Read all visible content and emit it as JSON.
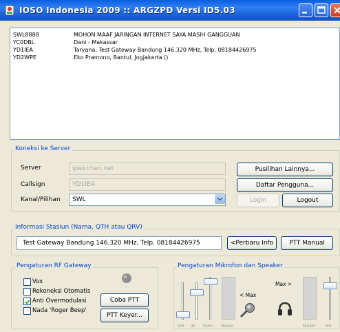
{
  "window": {
    "title": "IOSO Indonesia 2009 :: ARGZPD Versi ID5.03"
  },
  "log": {
    "rows": [
      {
        "callsign": "SWL8888",
        "message": "MOHON MAAF JARINGAN INTERNET SAYA MASIH GANGGUAN"
      },
      {
        "callsign": "YC0DBL",
        "message": "Dani - Makassar"
      },
      {
        "callsign": "YD1IEA",
        "message": "Taryana, Test Gateway Bandung 146.320 MHz, Telp. 08184426975"
      },
      {
        "callsign": "YD2WPE",
        "message": "Eko Pramono, Bantul, Jogjakarta ()"
      }
    ]
  },
  "server": {
    "group_title": "Koneksi ke Server",
    "server_label": "Server",
    "server_value": "ipso.irtari.net",
    "callsign_label": "Callsign",
    "callsign_value": "YD1IEA",
    "channel_label": "Kanal/Pilihan",
    "channel_value": "SWL",
    "more_button": "Pusilihan Lainnya...",
    "users_button": "Daftar Pengguna...",
    "login_button": "Login",
    "logout_button": "Logout"
  },
  "station": {
    "group_title": "Informasi Stasiun (Nama, QTH atau QRV)",
    "info_value": "Test Gateway Bandung 146.320 MHz, Telp. 08184426975",
    "update_button": "<Perbaru Info",
    "ptt_manual_button": "PTT Manual"
  },
  "rf_gateway": {
    "group_title": "Pengaturan RF Gateway",
    "options": [
      {
        "label": "Vox",
        "checked": false
      },
      {
        "label": "Rekoneksi Otomatis",
        "checked": false
      },
      {
        "label": "Anti Overmodulasi",
        "checked": true
      },
      {
        "label": "Nada 'Roger Beep'",
        "checked": false
      }
    ],
    "test_ptt_button": "Coba PTT",
    "ptt_keyer_button": "PTT Keyer..."
  },
  "audio": {
    "group_title": "Pengaturan Mikrofon dan Speaker",
    "mic_max_label": "< Max",
    "speaker_max_label": "Max >",
    "bottom_labels": [
      "Vol",
      "Bl",
      "Gain",
      "Meter",
      "Meter",
      "Vol"
    ]
  },
  "colors": {
    "title_blue": "#1d63d8",
    "group_title_blue": "#0046d5"
  }
}
